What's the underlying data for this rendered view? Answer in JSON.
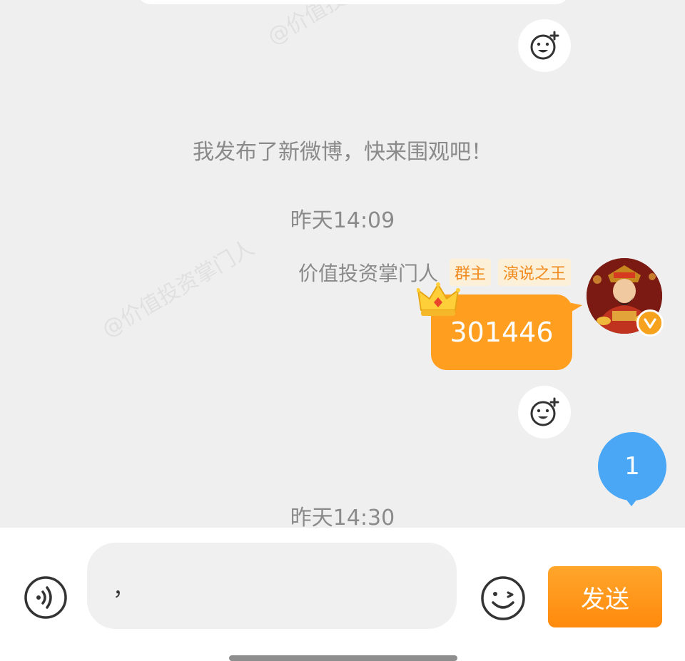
{
  "watermark": "@价值投资掌门人",
  "messages": {
    "system_share": "我发布了新微博，快来围观吧！",
    "time_1": "昨天14:09",
    "time_2": "昨天14:30"
  },
  "sender": {
    "name": "价值投资掌门人",
    "tags": [
      "群主",
      "演说之王"
    ]
  },
  "bubble": {
    "text": "301446",
    "color": "#ff9e1f"
  },
  "unread": {
    "count": "1",
    "color": "#4aa7f5"
  },
  "input": {
    "value": "，",
    "send_label": "发送"
  },
  "icons": [
    "add-reaction-icon",
    "crown-icon",
    "verified-v-icon",
    "voice-icon",
    "emoji-icon"
  ]
}
